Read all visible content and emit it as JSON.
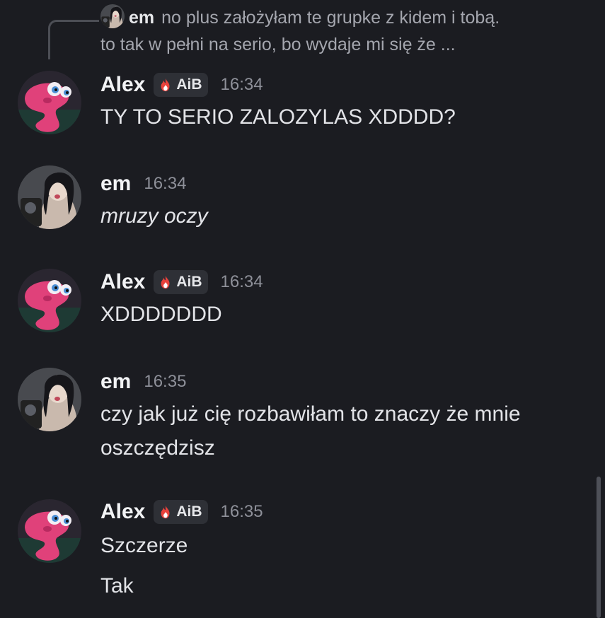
{
  "reply": {
    "author": "em",
    "line1": "no plus założyłam te grupke z kidem i tobą.",
    "line2": "to tak w pełni na serio, bo wydaje mi się że ..."
  },
  "messages": [
    {
      "author": "Alex",
      "tag": "AiB",
      "time": "16:34",
      "lines": [
        "TY TO SERIO ZALOZYLAS XDDDD?"
      ]
    },
    {
      "author": "em",
      "time": "16:34",
      "lines": [
        "mruzy oczy"
      ]
    },
    {
      "author": "Alex",
      "tag": "AiB",
      "time": "16:34",
      "lines": [
        "XDDDDDDD"
      ]
    },
    {
      "author": "em",
      "time": "16:35",
      "lines": [
        "czy jak już cię rozbawiłam to znaczy że mnie",
        "oszczędzisz"
      ]
    },
    {
      "author": "Alex",
      "tag": "AiB",
      "time": "16:35",
      "lines": [
        "Szczerze",
        "Tak"
      ]
    }
  ],
  "icons": {
    "alex_avatar": "pink-worm-avatar",
    "em_avatar": "user-photo-avatar",
    "tag_icon": "fire-icon"
  },
  "colors": {
    "background": "#1b1c21",
    "alex_avatar": "#e0417a",
    "tag_bg": "#2e3036",
    "flame": "#e8423c"
  }
}
